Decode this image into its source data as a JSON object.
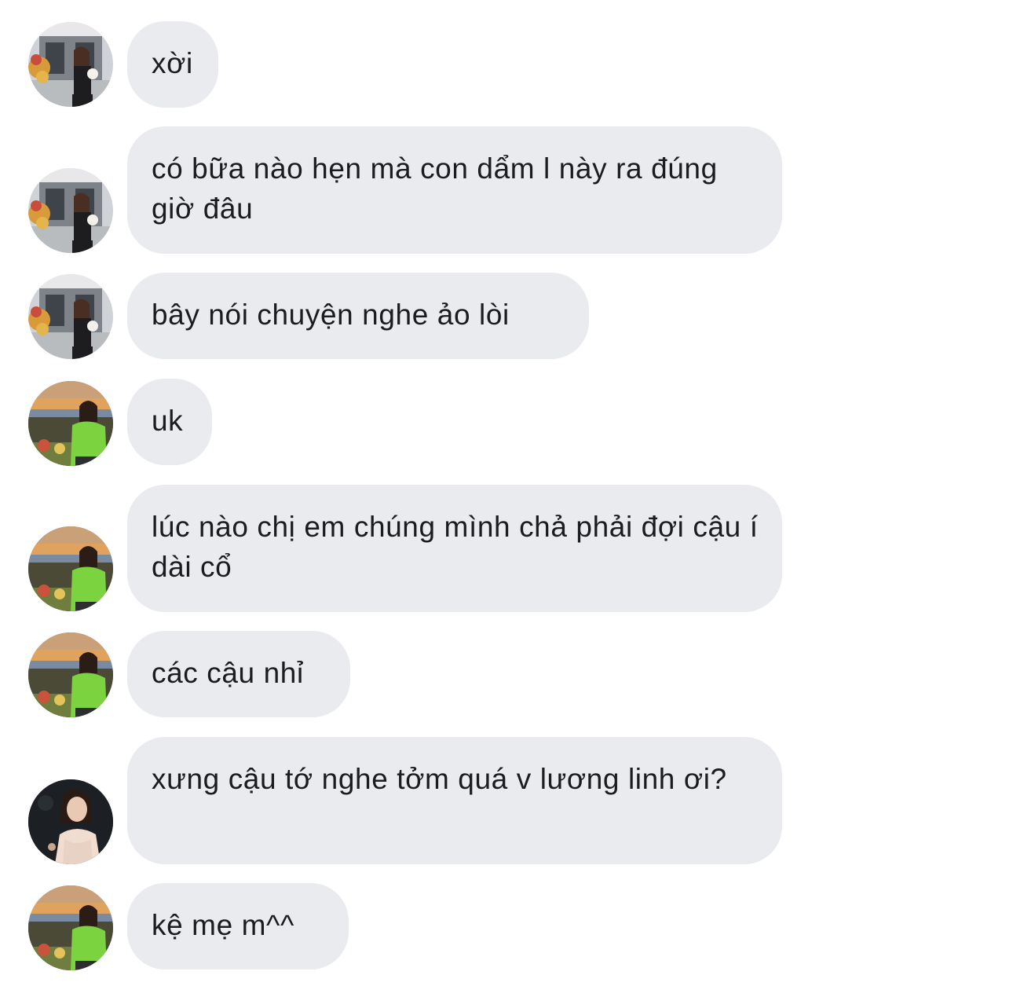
{
  "thread": {
    "messages": [
      {
        "sender": "user-a",
        "text": "xời"
      },
      {
        "sender": "user-a",
        "text": "có bữa nào hẹn mà con dẩm l này ra đúng giờ đâu"
      },
      {
        "sender": "user-a",
        "text": "bây nói chuyện nghe ảo lòi"
      },
      {
        "sender": "user-b",
        "text": "uk"
      },
      {
        "sender": "user-b",
        "text": "lúc nào chị em chúng mình chả phải đợi cậu í dài cổ"
      },
      {
        "sender": "user-b",
        "text": "các cậu nhỉ"
      },
      {
        "sender": "user-c",
        "text": "xưng cậu tớ nghe tởm quá v lương linh ơi?"
      },
      {
        "sender": "user-b",
        "text": "kệ mẹ m^^"
      }
    ]
  },
  "colors": {
    "bubble_background": "#e9ebef",
    "text": "#1c1c1e",
    "page_background": "#ffffff"
  }
}
